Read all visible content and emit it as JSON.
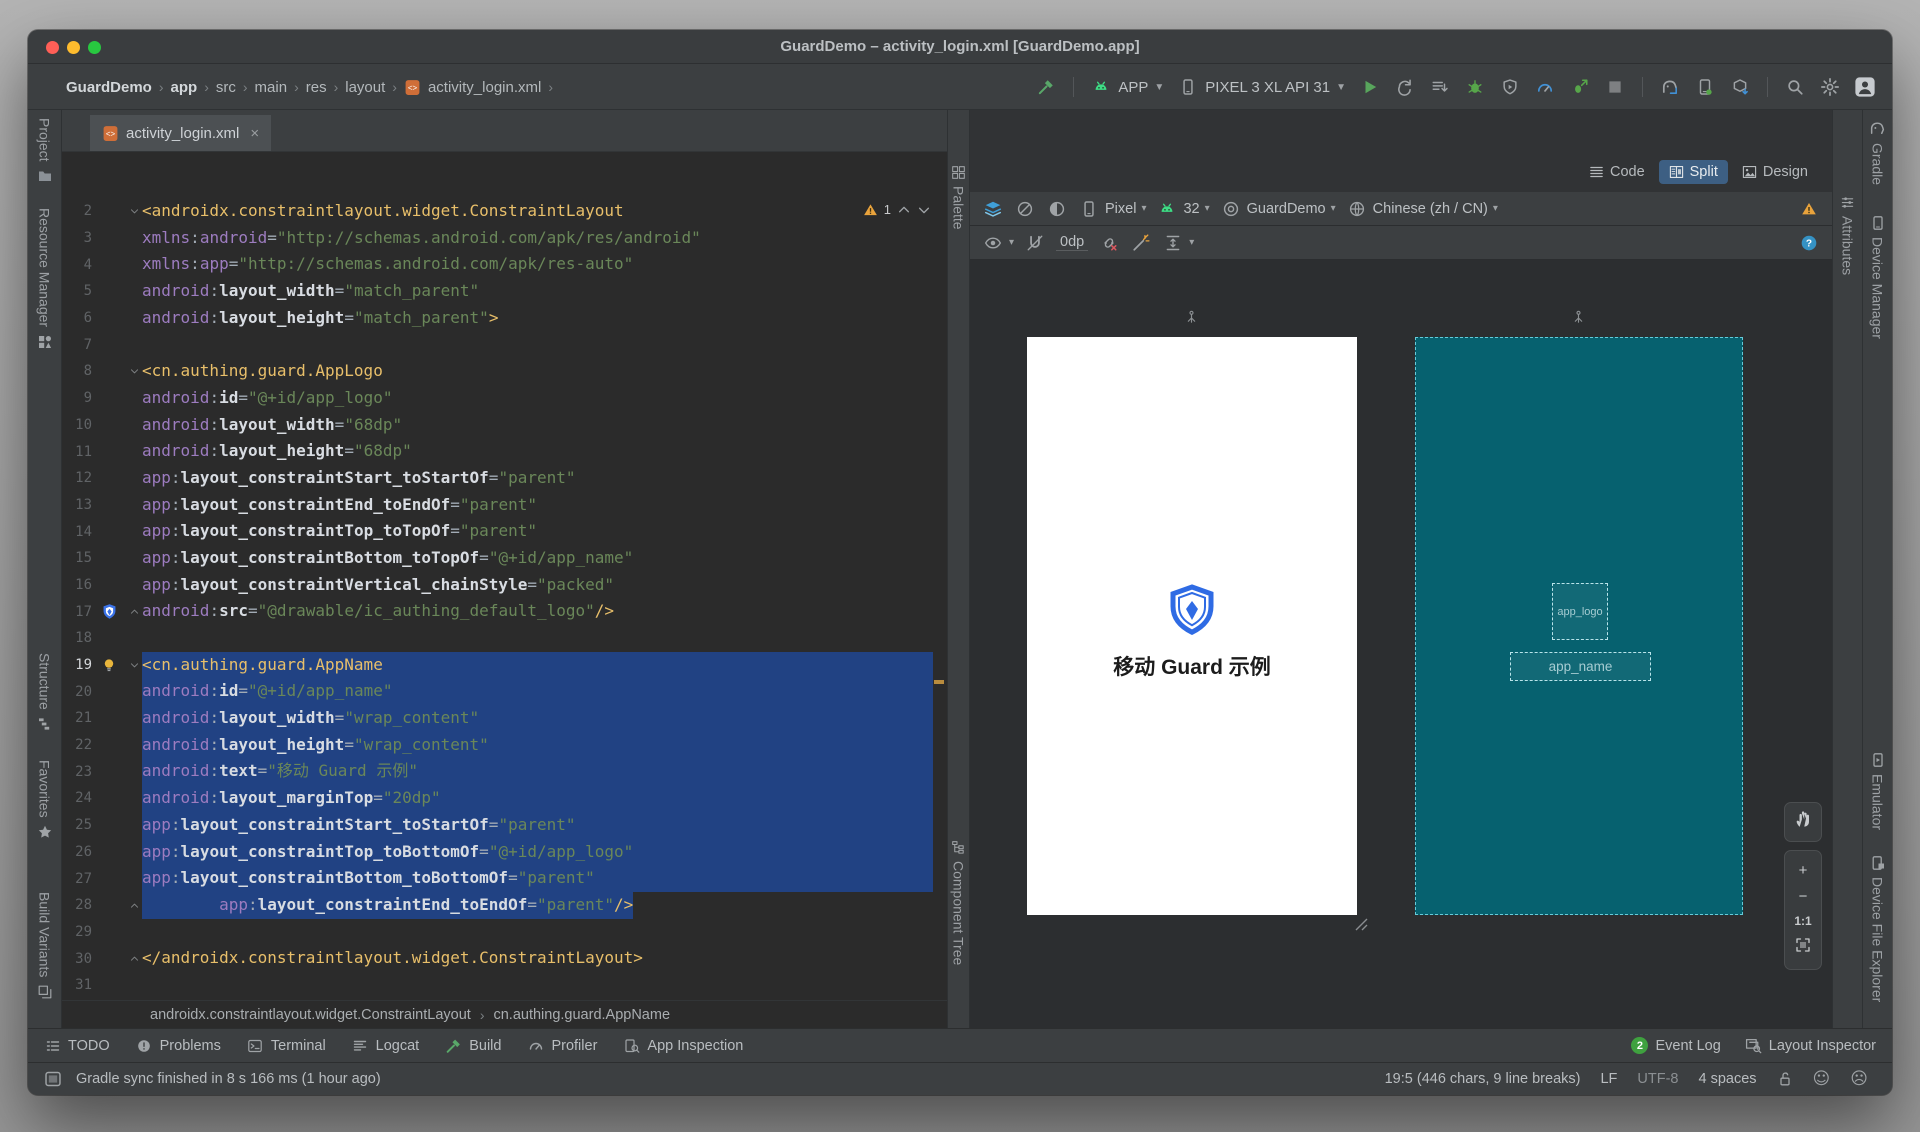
{
  "window": {
    "title": "GuardDemo – activity_login.xml [GuardDemo.app]"
  },
  "toolbar": {
    "breadcrumbs": [
      "GuardDemo",
      "app",
      "src",
      "main",
      "res",
      "layout",
      "activity_login.xml"
    ],
    "run_config": "APP",
    "device": "PIXEL 3 XL API 31",
    "build_icon": "build-hammer",
    "run_actions": [
      "run",
      "attach-debugger",
      "apply-changes",
      "debug",
      "apply-code-changes",
      "profile",
      "profile-low-overhead",
      "stop"
    ],
    "device_actions": [
      "gradle-sync",
      "device-manager",
      "sdk-manager"
    ],
    "misc_actions": [
      "search-everywhere",
      "settings",
      "profile-avatar"
    ]
  },
  "left_strip": {
    "top": [
      {
        "label": "Project",
        "icon": "folder"
      },
      {
        "label": "Resource Manager",
        "icon": "resource"
      }
    ],
    "bottom": [
      {
        "label": "Structure",
        "icon": "structure"
      },
      {
        "label": "Favorites",
        "icon": "star"
      },
      {
        "label": "Build Variants",
        "icon": "variants"
      }
    ]
  },
  "right_strip": {
    "top": [
      {
        "label": "Gradle",
        "icon": "gradle"
      },
      {
        "label": "Device Manager",
        "icon": "devmgr"
      }
    ],
    "bottom": [
      {
        "label": "Emulator",
        "icon": "emulator"
      },
      {
        "label": "Device File Explorer",
        "icon": "dfe"
      }
    ]
  },
  "attr_strip": {
    "label": "Attributes",
    "icon": "attributes"
  },
  "editor": {
    "tab": "activity_login.xml",
    "tab_icon": "xmlfile",
    "warning_count": "1",
    "breadcrumb": [
      "androidx.constraintlayout.widget.ConstraintLayout",
      "cn.authing.guard.AppName"
    ],
    "lines": [
      {
        "n": 2,
        "i": 0,
        "f": "d",
        "seg": [
          [
            "t",
            "<androidx.constraintlayout.widget.ConstraintLayout"
          ]
        ]
      },
      {
        "n": 3,
        "i": 4,
        "seg": [
          [
            "p",
            "xmlns"
          ],
          [
            "o",
            ":"
          ],
          [
            "p",
            "android"
          ],
          [
            "o",
            "="
          ],
          [
            "s",
            "\"http://schemas.android.com/apk/res/android\""
          ]
        ]
      },
      {
        "n": 4,
        "i": 4,
        "seg": [
          [
            "p",
            "xmlns"
          ],
          [
            "o",
            ":"
          ],
          [
            "p",
            "app"
          ],
          [
            "o",
            "="
          ],
          [
            "s",
            "\"http://schemas.android.com/apk/res-auto\""
          ]
        ]
      },
      {
        "n": 5,
        "i": 4,
        "seg": [
          [
            "p",
            "android"
          ],
          [
            "o",
            ":"
          ],
          [
            "n",
            "layout_width"
          ],
          [
            "o",
            "="
          ],
          [
            "s",
            "\"match_parent\""
          ]
        ]
      },
      {
        "n": 6,
        "i": 4,
        "seg": [
          [
            "p",
            "android"
          ],
          [
            "o",
            ":"
          ],
          [
            "n",
            "layout_height"
          ],
          [
            "o",
            "="
          ],
          [
            "s",
            "\"match_parent\""
          ],
          [
            "t",
            ">"
          ]
        ]
      },
      {
        "n": 7,
        "i": 0,
        "seg": []
      },
      {
        "n": 8,
        "i": 4,
        "f": "d",
        "seg": [
          [
            "t",
            "<cn.authing.guard.AppLogo"
          ]
        ]
      },
      {
        "n": 9,
        "i": 8,
        "seg": [
          [
            "p",
            "android"
          ],
          [
            "o",
            ":"
          ],
          [
            "n",
            "id"
          ],
          [
            "o",
            "="
          ],
          [
            "s",
            "\"@+id/app_logo\""
          ]
        ]
      },
      {
        "n": 10,
        "i": 8,
        "seg": [
          [
            "p",
            "android"
          ],
          [
            "o",
            ":"
          ],
          [
            "n",
            "layout_width"
          ],
          [
            "o",
            "="
          ],
          [
            "s",
            "\"68dp\""
          ]
        ]
      },
      {
        "n": 11,
        "i": 8,
        "seg": [
          [
            "p",
            "android"
          ],
          [
            "o",
            ":"
          ],
          [
            "n",
            "layout_height"
          ],
          [
            "o",
            "="
          ],
          [
            "s",
            "\"68dp\""
          ]
        ]
      },
      {
        "n": 12,
        "i": 8,
        "seg": [
          [
            "p",
            "app"
          ],
          [
            "o",
            ":"
          ],
          [
            "n",
            "layout_constraintStart_toStartOf"
          ],
          [
            "o",
            "="
          ],
          [
            "s",
            "\"parent\""
          ]
        ]
      },
      {
        "n": 13,
        "i": 8,
        "seg": [
          [
            "p",
            "app"
          ],
          [
            "o",
            ":"
          ],
          [
            "n",
            "layout_constraintEnd_toEndOf"
          ],
          [
            "o",
            "="
          ],
          [
            "s",
            "\"parent\""
          ]
        ]
      },
      {
        "n": 14,
        "i": 8,
        "seg": [
          [
            "p",
            "app"
          ],
          [
            "o",
            ":"
          ],
          [
            "n",
            "layout_constraintTop_toTopOf"
          ],
          [
            "o",
            "="
          ],
          [
            "s",
            "\"parent\""
          ]
        ]
      },
      {
        "n": 15,
        "i": 8,
        "seg": [
          [
            "p",
            "app"
          ],
          [
            "o",
            ":"
          ],
          [
            "n",
            "layout_constraintBottom_toTopOf"
          ],
          [
            "o",
            "="
          ],
          [
            "s",
            "\"@+id/app_name\""
          ]
        ]
      },
      {
        "n": 16,
        "i": 8,
        "seg": [
          [
            "p",
            "app"
          ],
          [
            "o",
            ":"
          ],
          [
            "n",
            "layout_constraintVertical_chainStyle"
          ],
          [
            "o",
            "="
          ],
          [
            "s",
            "\"packed\""
          ]
        ]
      },
      {
        "n": 17,
        "i": 8,
        "f": "u",
        "g": "shield",
        "seg": [
          [
            "p",
            "android"
          ],
          [
            "o",
            ":"
          ],
          [
            "n",
            "src"
          ],
          [
            "o",
            "="
          ],
          [
            "s",
            "\"@drawable/ic_authing_default_logo\""
          ],
          [
            "t",
            "/>"
          ]
        ]
      },
      {
        "n": 18,
        "i": 0,
        "seg": []
      },
      {
        "n": 19,
        "i": 4,
        "f": "d",
        "g": "bulb",
        "sel": "start",
        "seg": [
          [
            "t",
            "<cn.authing.guard.AppName"
          ]
        ]
      },
      {
        "n": 20,
        "i": 8,
        "sel": "mid",
        "seg": [
          [
            "p",
            "android"
          ],
          [
            "o",
            ":"
          ],
          [
            "n",
            "id"
          ],
          [
            "o",
            "="
          ],
          [
            "s",
            "\"@+id/app_name\""
          ]
        ]
      },
      {
        "n": 21,
        "i": 8,
        "sel": "mid",
        "seg": [
          [
            "p",
            "android"
          ],
          [
            "o",
            ":"
          ],
          [
            "n",
            "layout_width"
          ],
          [
            "o",
            "="
          ],
          [
            "s",
            "\"wrap_content\""
          ]
        ]
      },
      {
        "n": 22,
        "i": 8,
        "sel": "mid",
        "seg": [
          [
            "p",
            "android"
          ],
          [
            "o",
            ":"
          ],
          [
            "n",
            "layout_height"
          ],
          [
            "o",
            "="
          ],
          [
            "s",
            "\"wrap_content\""
          ]
        ]
      },
      {
        "n": 23,
        "i": 8,
        "sel": "mid",
        "seg": [
          [
            "p",
            "android"
          ],
          [
            "o",
            ":"
          ],
          [
            "n",
            "text"
          ],
          [
            "o",
            "="
          ],
          [
            "s",
            "\"移动 Guard 示例\""
          ]
        ]
      },
      {
        "n": 24,
        "i": 8,
        "sel": "mid",
        "seg": [
          [
            "p",
            "android"
          ],
          [
            "o",
            ":"
          ],
          [
            "n",
            "layout_marginTop"
          ],
          [
            "o",
            "="
          ],
          [
            "s",
            "\"20dp\""
          ]
        ]
      },
      {
        "n": 25,
        "i": 8,
        "sel": "mid",
        "seg": [
          [
            "p",
            "app"
          ],
          [
            "o",
            ":"
          ],
          [
            "n",
            "layout_constraintStart_toStartOf"
          ],
          [
            "o",
            "="
          ],
          [
            "s",
            "\"parent\""
          ]
        ]
      },
      {
        "n": 26,
        "i": 8,
        "sel": "mid",
        "seg": [
          [
            "p",
            "app"
          ],
          [
            "o",
            ":"
          ],
          [
            "n",
            "layout_constraintTop_toBottomOf"
          ],
          [
            "o",
            "="
          ],
          [
            "s",
            "\"@+id/app_logo\""
          ]
        ]
      },
      {
        "n": 27,
        "i": 8,
        "sel": "mid",
        "seg": [
          [
            "p",
            "app"
          ],
          [
            "o",
            ":"
          ],
          [
            "n",
            "layout_constraintBottom_toBottomOf"
          ],
          [
            "o",
            "="
          ],
          [
            "s",
            "\"parent\""
          ]
        ]
      },
      {
        "n": 28,
        "i": 8,
        "f": "u",
        "sel": "end",
        "seg": [
          [
            "p",
            "app"
          ],
          [
            "o",
            ":"
          ],
          [
            "n",
            "layout_constraintEnd_toEndOf"
          ],
          [
            "o",
            "="
          ],
          [
            "s",
            "\"parent\""
          ],
          [
            "t",
            "/>"
          ]
        ]
      },
      {
        "n": 29,
        "i": 0,
        "seg": []
      },
      {
        "n": 30,
        "i": 0,
        "f": "u",
        "seg": [
          [
            "t",
            "</androidx.constraintlayout.widget.ConstraintLayout>"
          ]
        ]
      },
      {
        "n": 31,
        "i": 0,
        "seg": []
      }
    ]
  },
  "design": {
    "modes": [
      {
        "label": "Code",
        "icon": "mode-code"
      },
      {
        "label": "Split",
        "icon": "mode-split",
        "active": true
      },
      {
        "label": "Design",
        "icon": "mode-design"
      }
    ],
    "device": "Pixel",
    "api": "32",
    "theme": "GuardDemo",
    "locale": "Chinese (zh / CN)",
    "margin": "0dp",
    "palette_label": "Palette",
    "component_tree_label": "Component Tree",
    "zoom_label": "1:1",
    "row1_icons": [
      "design-layers",
      "erase",
      "theme-toggle"
    ],
    "row2_icons_left": [
      "view-options",
      "magnet-off"
    ],
    "row2_icons_right": [
      "clear-constraints",
      "infer-constraints",
      "pack-distribute"
    ],
    "preview": {
      "app_name": "移动 Guard 示例",
      "logo_color": "#2f6be4"
    },
    "blueprint": {
      "logo_label": "app_logo",
      "name_label": "app_name",
      "bg": "#06616f"
    }
  },
  "bottom_bar": {
    "tabs": [
      {
        "label": "TODO",
        "icon": "todo"
      },
      {
        "label": "Problems",
        "icon": "problems"
      },
      {
        "label": "Terminal",
        "icon": "terminal"
      },
      {
        "label": "Logcat",
        "icon": "logcat"
      },
      {
        "label": "Build",
        "icon": "build-hammer"
      },
      {
        "label": "Profiler",
        "icon": "profiler"
      },
      {
        "label": "App Inspection",
        "icon": "app-inspection"
      }
    ],
    "event_log": {
      "badge": "2",
      "label": "Event Log"
    },
    "layout_inspector": "Layout Inspector"
  },
  "status_bar": {
    "message": "Gradle sync finished in 8 s 166 ms (1 hour ago)",
    "caret": "19:5 (446 chars, 9 line breaks)",
    "line_ending": "LF",
    "encoding": "UTF-8",
    "indent": "4 spaces"
  }
}
